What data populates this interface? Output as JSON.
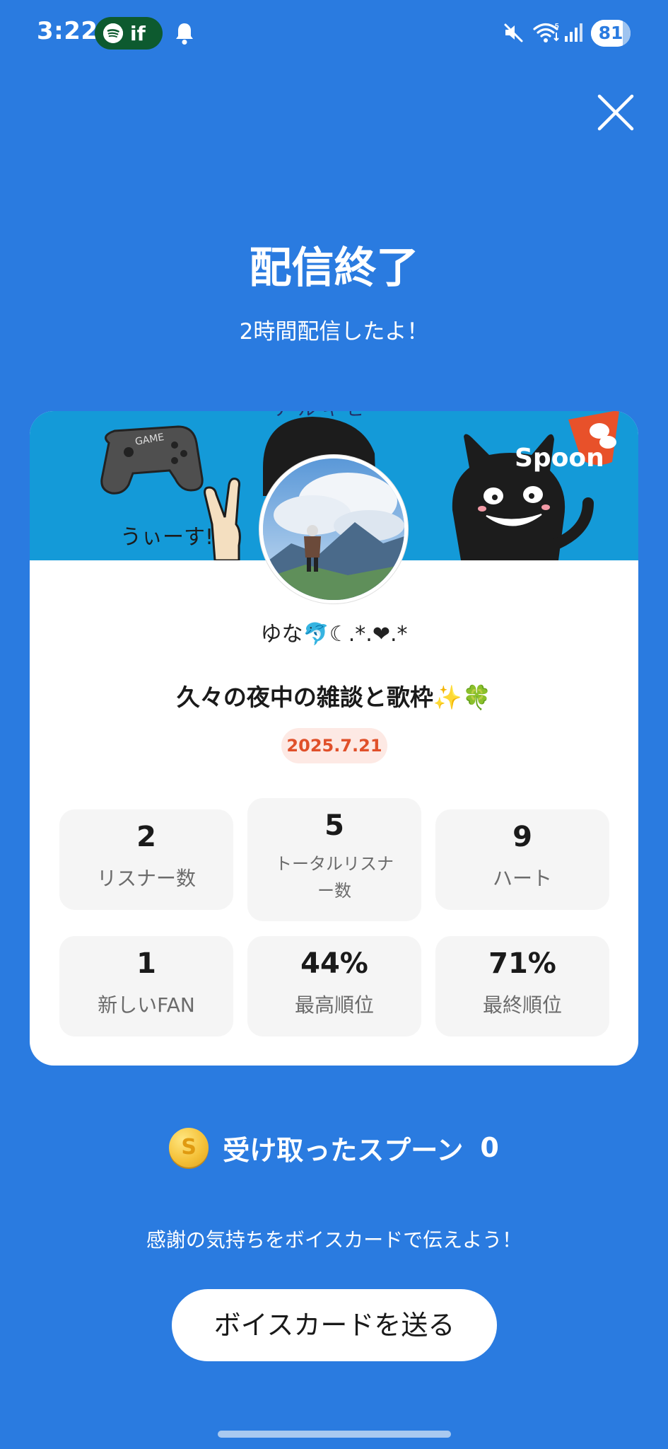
{
  "status_bar": {
    "time": "3:22",
    "spotify_label": "if",
    "battery_level": "81",
    "battery_fraction": 0.81,
    "icons": [
      "spotify-icon",
      "bell-icon",
      "mute-icon",
      "wifi-icon",
      "signal-icon",
      "battery-icon"
    ]
  },
  "header": {
    "close_icon": "close-icon",
    "title": "配信終了",
    "subtitle": "2時間配信したよ！"
  },
  "card": {
    "banner": {
      "brand": "Spoon",
      "scribble": "うぃーす!!"
    },
    "host_name": "ゆな🐬☾.*.❤.*",
    "live_title": "久々の夜中の雑談と歌枠✨🍀",
    "date": "2025.7.21",
    "stats": [
      {
        "value": "2",
        "label": "リスナー数"
      },
      {
        "value": "5",
        "label": "トータルリスナー数",
        "label_line1": "トータルリスナ",
        "label_line2": "ー数"
      },
      {
        "value": "9",
        "label": "ハート"
      },
      {
        "value": "1",
        "label": "新しいFAN"
      },
      {
        "value": "44%",
        "label": "最高順位"
      },
      {
        "value": "71%",
        "label": "最終順位"
      }
    ]
  },
  "spoons": {
    "icon": "coin-icon",
    "coin_letter": "S",
    "label": "受け取ったスプーン",
    "count": "0"
  },
  "thanks_message": "感謝の気持ちをボイスカードで伝えよう！",
  "voice_card_button": "ボイスカードを送る",
  "colors": {
    "background": "#2a7be0",
    "card": "#ffffff",
    "date_badge_text": "#e0502a",
    "date_badge_bg": "#fde9e4",
    "tile_bg": "#f5f5f5",
    "spotify_pill": "#0d5a2f"
  }
}
